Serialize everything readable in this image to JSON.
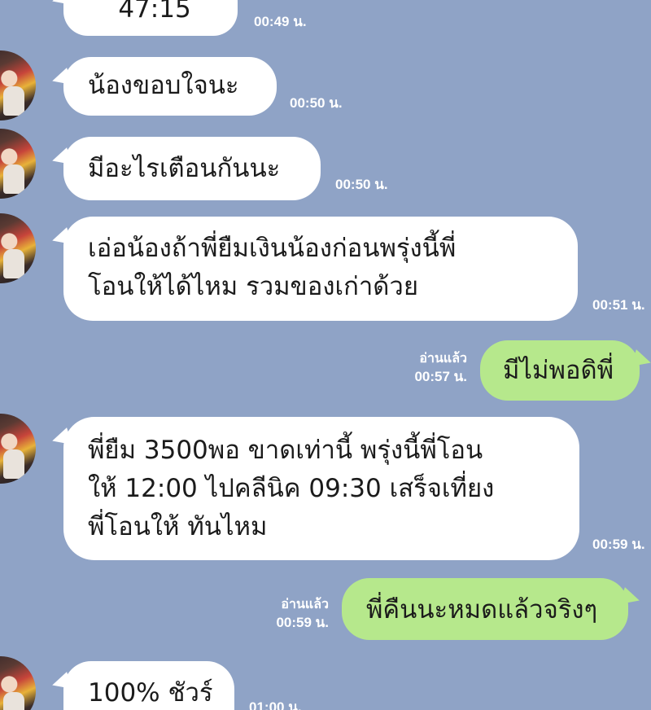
{
  "messages": [
    {
      "from": "them",
      "lines": [
        "47:15"
      ],
      "time": "00:49 น."
    },
    {
      "from": "them",
      "lines": [
        "น้องขอบใจนะ"
      ],
      "time": "00:50 น."
    },
    {
      "from": "them",
      "lines": [
        "มีอะไรเตือนกันนะ"
      ],
      "time": "00:50 น."
    },
    {
      "from": "them",
      "lines": [
        "เอ่อน้องถ้าพี่ยืมเงินน้องก่อนพรุ่งนี้พี่",
        "โอนให้ได้ไหม รวมของเก่าด้วย"
      ],
      "time": "00:51 น."
    },
    {
      "from": "me",
      "lines": [
        "มีไม่พอดิพี่"
      ],
      "read": "อ่านแล้ว",
      "time": "00:57 น."
    },
    {
      "from": "them",
      "lines": [
        "พี่ยืม 3500พอ ขาดเท่านี้ พรุ่งนี้พี่โอน",
        "ให้ 12:00 ไปคลีนิค 09:30 เสร็จเที่ยง",
        "พี่โอนให้ ทันไหม"
      ],
      "time": "00:59 น."
    },
    {
      "from": "me",
      "lines": [
        "พี่คืนนะหมดแล้วจริงๆ"
      ],
      "read": "อ่านแล้ว",
      "time": "00:59 น."
    },
    {
      "from": "them",
      "lines": [
        "100% ชัวร์"
      ],
      "time": "01:00 น."
    }
  ],
  "colors": {
    "background": "#8fa3c6",
    "incoming_bubble": "#ffffff",
    "outgoing_bubble": "#b6e88c",
    "meta_text": "#ffffff"
  }
}
